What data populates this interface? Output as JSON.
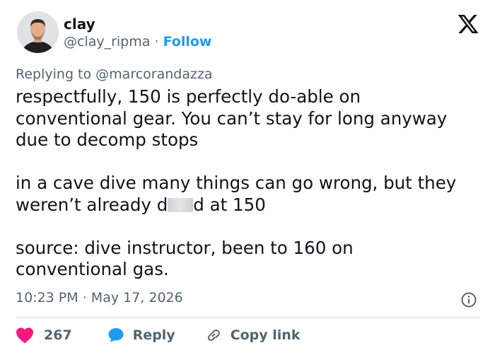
{
  "author": {
    "name": "clay",
    "handle": "@clay_ripma",
    "separator": "·",
    "follow_label": "Follow"
  },
  "reply_context": {
    "prefix": "Replying to",
    "mention": "@marcorandazza"
  },
  "tweet": {
    "lines": [
      "respectfully, 150 is perfectly do-able on",
      "conventional gear. You can’t stay for long anyway",
      "due to decomp stops",
      "in a cave dive many things can go wrong, but they",
      "weren’t already d",
      "d at 150",
      "source: dive instructor, been to 160 on",
      "conventional gas."
    ]
  },
  "meta": {
    "time": "10:23 PM",
    "separator": "·",
    "date": "May 17, 2026"
  },
  "actions": {
    "like_count": "267",
    "reply_label": "Reply",
    "copy_link_label": "Copy link"
  },
  "colors": {
    "text": "#0f1419",
    "secondary": "#536471",
    "link": "#1d9bf0",
    "like": "#f91880",
    "reply": "#1d9bf0",
    "divider": "#cfd9de"
  },
  "icons": {
    "logo": "x-logo-icon",
    "info": "info-icon",
    "like": "heart-icon",
    "reply": "speech-bubble-icon",
    "copy": "link-icon"
  }
}
